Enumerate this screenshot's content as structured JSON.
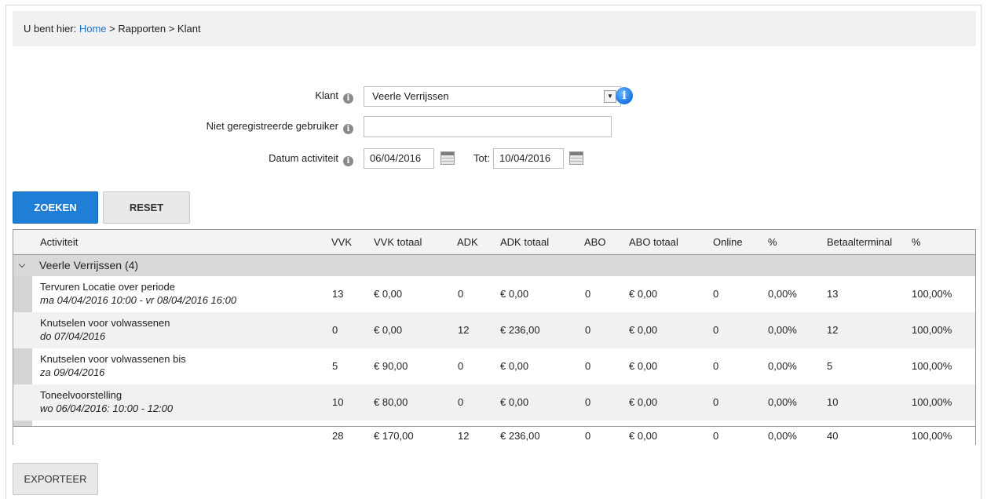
{
  "breadcrumb": {
    "prefix": "U bent hier:",
    "home": "Home",
    "separator": ">",
    "items": [
      "Rapporten",
      "Klant"
    ]
  },
  "form": {
    "klant_label": "Klant",
    "klant_value": "Veerle Verrijssen",
    "unregistered_label": "Niet geregistreerde gebruiker",
    "unregistered_value": "",
    "date_label": "Datum activiteit",
    "date_from": "06/04/2016",
    "date_to_label": "Tot:",
    "date_to": "10/04/2016"
  },
  "buttons": {
    "search": "ZOEKEN",
    "reset": "RESET",
    "export": "EXPORTEER"
  },
  "table": {
    "headers": [
      "Activiteit",
      "VVK",
      "VVK totaal",
      "ADK",
      "ADK totaal",
      "ABO",
      "ABO totaal",
      "Online",
      "%",
      "Betaalterminal",
      "%"
    ],
    "group_label": "Veerle Verrijssen (4)",
    "rows": [
      {
        "name": "Tervuren Locatie over periode",
        "date": "ma 04/04/2016 10:00 - vr 08/04/2016 16:00",
        "vvk": "13",
        "vvk_totaal": "€ 0,00",
        "adk": "0",
        "adk_totaal": "€ 0,00",
        "abo": "0",
        "abo_totaal": "€ 0,00",
        "online": "0",
        "pct1": "0,00%",
        "betaalterminal": "13",
        "pct2": "100,00%"
      },
      {
        "name": "Knutselen voor volwassenen",
        "date": "do 07/04/2016",
        "vvk": "0",
        "vvk_totaal": "€ 0,00",
        "adk": "12",
        "adk_totaal": "€ 236,00",
        "abo": "0",
        "abo_totaal": "€ 0,00",
        "online": "0",
        "pct1": "0,00%",
        "betaalterminal": "12",
        "pct2": "100,00%"
      },
      {
        "name": "Knutselen voor volwassenen bis",
        "date": "za 09/04/2016",
        "vvk": "5",
        "vvk_totaal": "€ 90,00",
        "adk": "0",
        "adk_totaal": "€ 0,00",
        "abo": "0",
        "abo_totaal": "€ 0,00",
        "online": "0",
        "pct1": "0,00%",
        "betaalterminal": "5",
        "pct2": "100,00%"
      },
      {
        "name": "Toneelvoorstelling",
        "date": "wo 06/04/2016: 10:00 - 12:00",
        "vvk": "10",
        "vvk_totaal": "€ 80,00",
        "adk": "0",
        "adk_totaal": "€ 0,00",
        "abo": "0",
        "abo_totaal": "€ 0,00",
        "online": "0",
        "pct1": "0,00%",
        "betaalterminal": "10",
        "pct2": "100,00%"
      }
    ],
    "totals": {
      "vvk": "28",
      "vvk_totaal": "€ 170,00",
      "adk": "12",
      "adk_totaal": "€ 236,00",
      "abo": "0",
      "abo_totaal": "€ 0,00",
      "online": "0",
      "pct1": "0,00%",
      "betaalterminal": "40",
      "pct2": "100,00%"
    }
  },
  "colors": {
    "primary_button": "#1f7ed6",
    "link": "#1a73c8",
    "info_icon": "#1774e0"
  }
}
